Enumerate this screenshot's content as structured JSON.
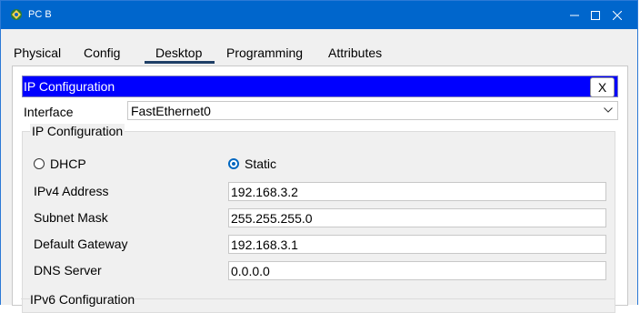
{
  "window": {
    "title": "PC B",
    "icon": "pc-app-icon",
    "controls": [
      "minimize-icon",
      "maximize-icon",
      "close-icon"
    ],
    "accent": "#0066cc"
  },
  "tabs": [
    {
      "label": "Physical",
      "active": false
    },
    {
      "label": "Config",
      "active": false
    },
    {
      "label": "Desktop",
      "active": true
    },
    {
      "label": "Programming",
      "active": false
    },
    {
      "label": "Attributes",
      "active": false
    }
  ],
  "panel": {
    "title": "IP Configuration",
    "close_label": "X",
    "header_color": "#0000ff"
  },
  "interface": {
    "label": "Interface",
    "value": "FastEthernet0"
  },
  "ipv4": {
    "group_title": "IP Configuration",
    "mode": {
      "dhcp_label": "DHCP",
      "static_label": "Static",
      "selected": "Static"
    },
    "fields": [
      {
        "label": "IPv4 Address",
        "value": "192.168.3.2"
      },
      {
        "label": "Subnet Mask",
        "value": "255.255.255.0"
      },
      {
        "label": "Default Gateway",
        "value": "192.168.3.1"
      },
      {
        "label": "DNS Server",
        "value": "0.0.0.0"
      }
    ]
  },
  "ipv6": {
    "group_title": "IPv6 Configuration"
  }
}
